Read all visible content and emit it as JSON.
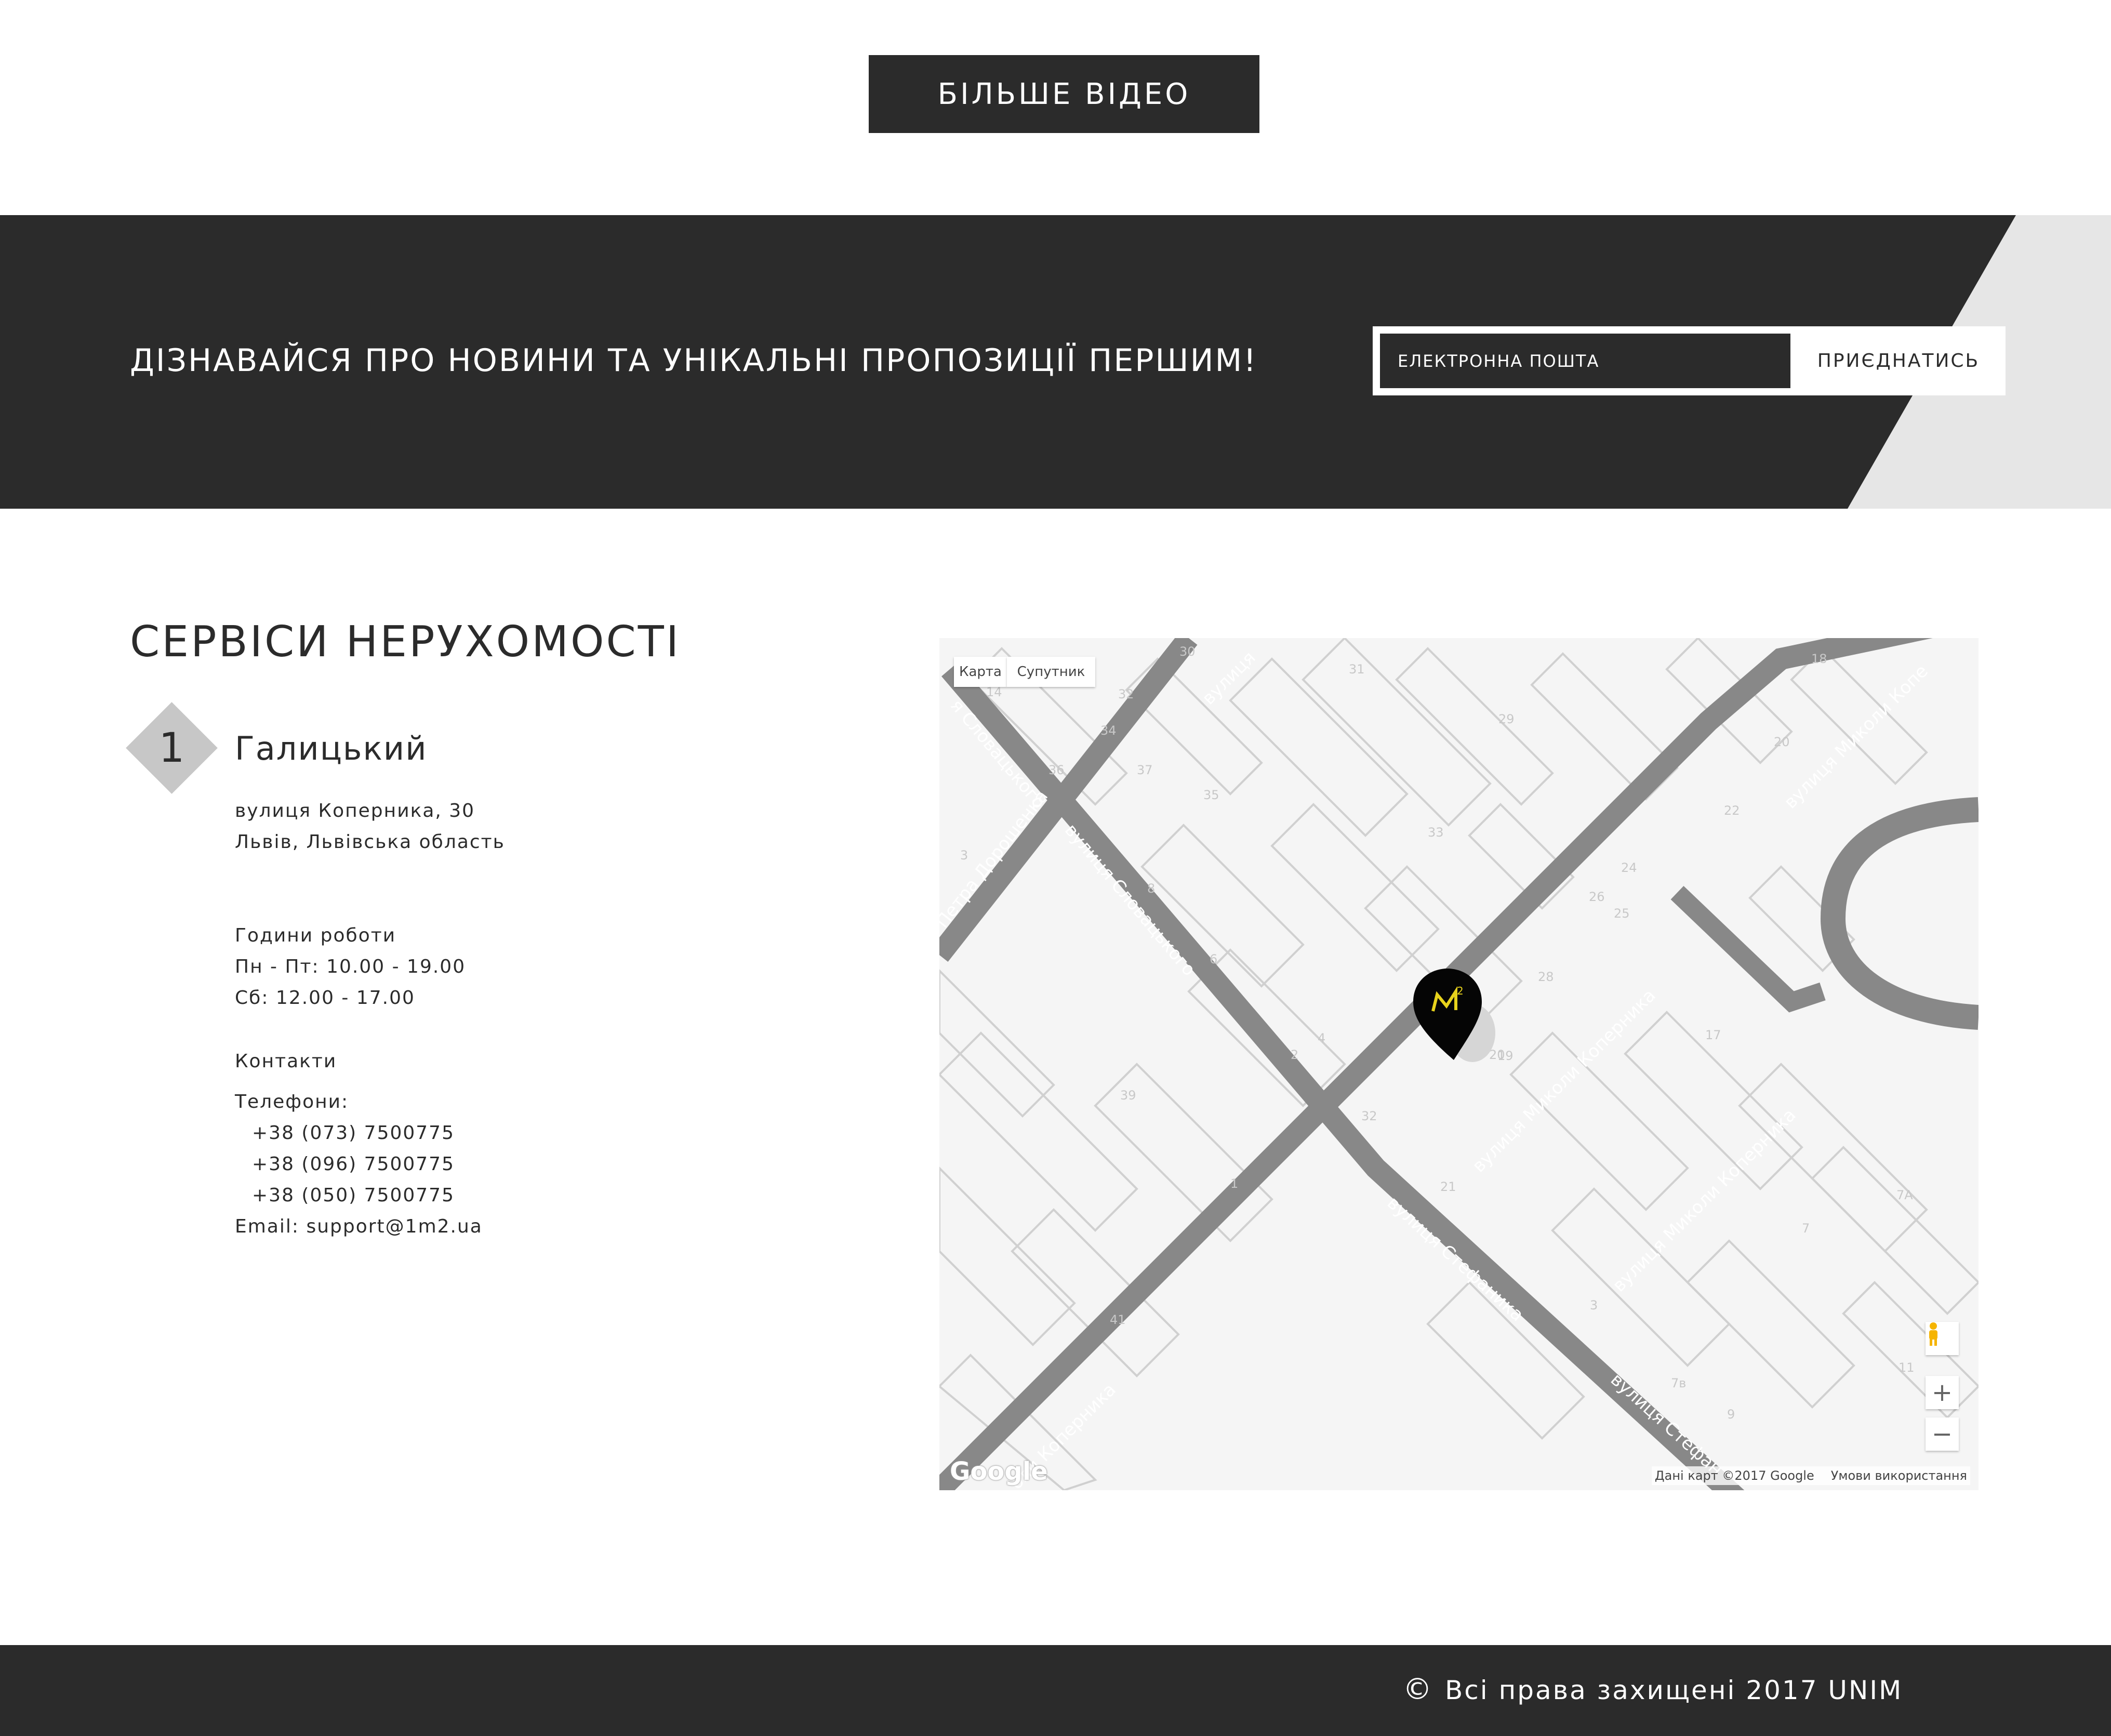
{
  "more_video": {
    "label": "БІЛЬШЕ ВІДЕО"
  },
  "newsletter": {
    "title": "ДІЗНАВАЙСЯ ПРО НОВИНИ ТА УНІКАЛЬНІ ПРОПОЗИЦІЇ ПЕРШИМ!",
    "email_placeholder": "ЕЛЕКТРОННА ПОШТА",
    "join_label": "ПРИЄДНАТИСЬ"
  },
  "services": {
    "title": "СЕРВІСИ НЕРУХОМОСТІ",
    "office": {
      "number": "1",
      "name": "Галицький",
      "address_line1": "вулиця Коперника, 30",
      "address_line2": "Львів, Львівська область",
      "hours_heading": "Години роботи",
      "hours_weekdays": "Пн - Пт: 10.00 - 19.00",
      "hours_saturday": "Сб: 12.00 - 17.00",
      "contacts_heading": "Контакти",
      "phones_heading": "Телефони:",
      "phones": [
        "+38 (073) 7500775",
        "+38 (096) 7500775",
        "+38 (050) 7500775"
      ],
      "email": "Email: support@1m2.ua"
    }
  },
  "map": {
    "type_map": "Карта",
    "type_satellite": "Супутник",
    "attribution": "Дані карт ©2017 Google",
    "terms": "Умови використання",
    "logo": "Google",
    "zoom_in": "+",
    "zoom_out": "−",
    "marker_icon": "map-pin-logo-icon",
    "pegman_icon": "street-view-pegman-icon",
    "streets": {
      "kopernyka_1": "вулиця Миколи Коперника",
      "kopernyka_2": "вулиця Миколи Коперника",
      "kopernyka_3": "оли Коперника",
      "kopernyka_top": "вулиця Миколи Копе",
      "slovatskoho_1": "вулиця Словацького",
      "slovatskoho_2": "я Словацького",
      "doroshenka": "Петра Дорошенка",
      "stefanyka_1": "вулиця Стефаника",
      "stefanyka_2": "вулиця Стефан",
      "top_street": "вулиця"
    },
    "building_numbers": [
      "30",
      "31",
      "18",
      "14",
      "32",
      "29",
      "34",
      "36",
      "37",
      "35",
      "20",
      "22",
      "33",
      "3",
      "8",
      "24",
      "26",
      "25",
      "6",
      "28",
      "4",
      "2",
      "17",
      "39",
      "32",
      "19",
      "1",
      "21",
      "7А",
      "7",
      "41",
      "3",
      "7в",
      "11",
      "9",
      "20"
    ]
  },
  "footer": {
    "copyright": "Всі права захищені 2017 UNIM",
    "copyright_symbol": "©"
  },
  "colors": {
    "dark": "#2b2b2b",
    "light_band": "#e6e6e6",
    "badge": "#c7c7c7",
    "white": "#ffffff"
  }
}
